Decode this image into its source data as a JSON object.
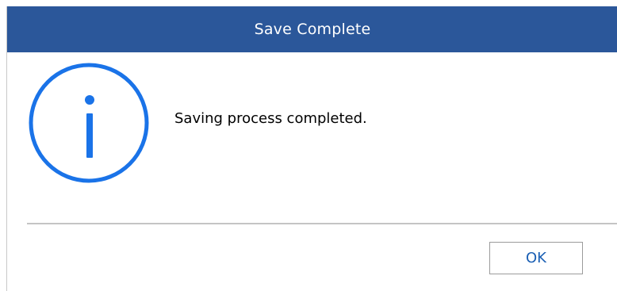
{
  "window": {
    "title": "Save Complete"
  },
  "dialog": {
    "icon": "info-icon",
    "message": "Saving process completed.",
    "ok_label": "OK"
  },
  "colors": {
    "titlebar": "#2b579a",
    "icon": "#1a73e8",
    "button_text": "#1a5fb4"
  }
}
